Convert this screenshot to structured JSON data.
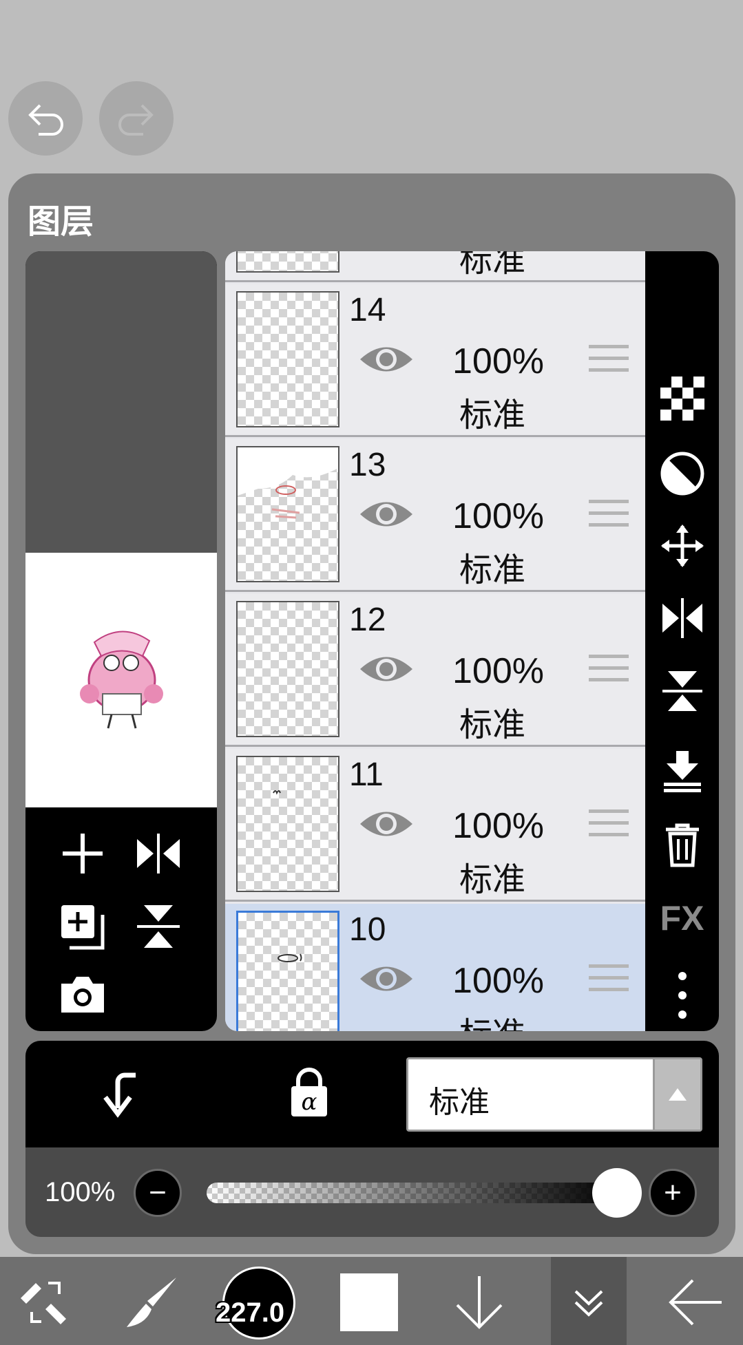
{
  "panel": {
    "title": "图层"
  },
  "layers": [
    {
      "num": "",
      "opacity": "",
      "blend": "标准"
    },
    {
      "num": "14",
      "opacity": "100%",
      "blend": "标准"
    },
    {
      "num": "13",
      "opacity": "100%",
      "blend": "标准"
    },
    {
      "num": "12",
      "opacity": "100%",
      "blend": "标准"
    },
    {
      "num": "11",
      "opacity": "100%",
      "blend": "标准"
    },
    {
      "num": "10",
      "opacity": "100%",
      "blend": "标准"
    }
  ],
  "right_tools": {
    "fx_label": "FX"
  },
  "blend_select": {
    "value": "标准"
  },
  "opacity": {
    "label": "100%",
    "value": 1.0,
    "minus": "−",
    "plus": "+"
  },
  "bottom_bar": {
    "brush_size": "227.0"
  },
  "colors": {
    "selected_row": "#cfdbef",
    "selected_border": "#3a7ad8",
    "panel": "#7f7f7f"
  },
  "icons": [
    "undo-icon",
    "redo-icon",
    "add-layer-icon",
    "flip-horizontal-icon",
    "copy-layer-icon",
    "flip-vertical-icon",
    "camera-icon",
    "eye-icon",
    "drag-handle-icon",
    "transparency-icon",
    "contrast-icon",
    "move-icon",
    "merge-down-icon",
    "trash-icon",
    "more-icon",
    "clip-icon",
    "alpha-lock-icon",
    "transform-tools-icon",
    "brush-icon",
    "arrow-down-icon",
    "chevron-down-icon",
    "back-icon"
  ]
}
